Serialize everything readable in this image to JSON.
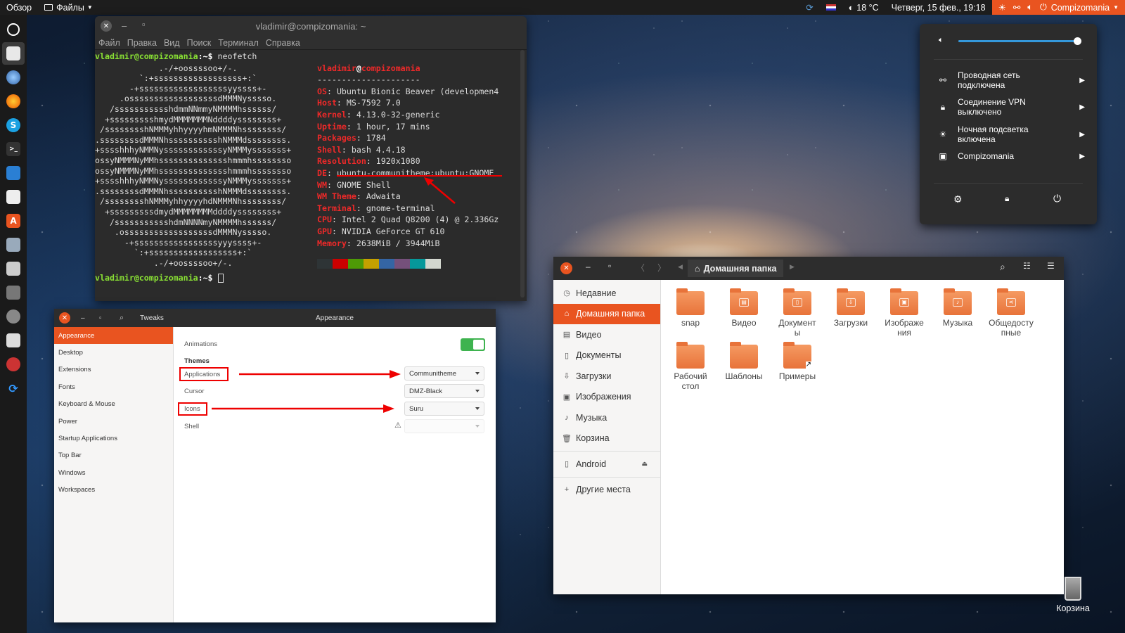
{
  "topbar": {
    "overview": "Обзор",
    "files_menu": "Файлы",
    "weather": "18 °C",
    "datetime": "Четверг, 15 фев., 19:18",
    "user": "Compizomania"
  },
  "terminal": {
    "title": "vladimir@compizomania: ~",
    "menu": [
      "Файл",
      "Правка",
      "Вид",
      "Поиск",
      "Терминал",
      "Справка"
    ],
    "prompt": "vladimir@compizomania",
    "prompt_suffix": ":~$",
    "command": "neofetch",
    "user": "vladimir",
    "host": "compizomania",
    "separator": "---------------------",
    "logo": [
      "             .-/+oossssoo+/-.",
      "         `:+ssssssssssssssssss+:`",
      "       -+ssssssssssssssssssyyssss+-",
      "     .ossssssssssssssssssdMMMNysssso.",
      "   /ssssssssssshdmmNNmmyNMMMMhssssss/",
      "  +ssssssssshmydMMMMMMMNddddyssssssss+",
      " /sssssssshNMMMyhhyyyyhmNMMMNhssssssss/",
      ".ssssssssdMMMNhsssssssssshNMMMdssssssss.",
      "+sssshhhyNMMNyssssssssssssyNMMMysssssss+",
      "ossyNMMMNyMMhsssssssssssssshmmmhssssssso",
      "ossyNMMMNyMMhsssssssssssssshmmmhssssssso",
      "+sssshhhyNMMNyssssssssssssyNMMMysssssss+",
      ".ssssssssdMMMNhsssssssssshNMMMdssssssss.",
      " /sssssssshNMMMyhhyyyyhdNMMMNhssssssss/",
      "  +sssssssssdmydMMMMMMMMddddyssssssss+",
      "   /ssssssssssshdmNNNNmyNMMMMhssssss/",
      "    .ossssssssssssssssssdMMMNysssso.",
      "      -+sssssssssssssssssyyyssss+-",
      "        `:+ssssssssssssssssss+:`",
      "            .-/+oossssoo+/-."
    ],
    "info": [
      {
        "key": "OS",
        "value": "Ubuntu Bionic Beaver (developmen4"
      },
      {
        "key": "Host",
        "value": "MS-7592 7.0"
      },
      {
        "key": "Kernel",
        "value": "4.13.0-32-generic"
      },
      {
        "key": "Uptime",
        "value": "1 hour, 17 mins"
      },
      {
        "key": "Packages",
        "value": "1784"
      },
      {
        "key": "Shell",
        "value": "bash 4.4.18"
      },
      {
        "key": "Resolution",
        "value": "1920x1080"
      },
      {
        "key": "DE",
        "value": "ubuntu-communitheme:ubuntu:GNOME"
      },
      {
        "key": "WM",
        "value": "GNOME Shell"
      },
      {
        "key": "WM Theme",
        "value": "Adwaita"
      },
      {
        "key": "Terminal",
        "value": "gnome-terminal"
      },
      {
        "key": "CPU",
        "value": "Intel 2 Quad Q8200 (4) @ 2.336Gz"
      },
      {
        "key": "GPU",
        "value": "NVIDIA GeForce GT 610"
      },
      {
        "key": "Memory",
        "value": "2638MiB / 3944MiB"
      }
    ],
    "palette": [
      "#2e3436",
      "#cc0000",
      "#4e9a06",
      "#c4a000",
      "#3465a4",
      "#75507b",
      "#06989a",
      "#d3d7cf"
    ]
  },
  "tweaks": {
    "app_title": "Tweaks",
    "panel_title": "Appearance",
    "sidebar": [
      "Appearance",
      "Desktop",
      "Extensions",
      "Fonts",
      "Keyboard & Mouse",
      "Power",
      "Startup Applications",
      "Top Bar",
      "Windows",
      "Workspaces"
    ],
    "animations_label": "Animations",
    "animations_on": true,
    "themes_heading": "Themes",
    "applications_label": "Applications",
    "applications_value": "Communitheme",
    "cursor_label": "Cursor",
    "cursor_value": "DMZ-Black",
    "icons_label": "Icons",
    "icons_value": "Suru",
    "shell_label": "Shell",
    "shell_value": ""
  },
  "files": {
    "path": "Домашняя папка",
    "sidebar": [
      {
        "label": "Недавние",
        "icon": "clock-icon"
      },
      {
        "label": "Домашняя папка",
        "icon": "home-icon"
      },
      {
        "label": "Видео",
        "icon": "video-icon"
      },
      {
        "label": "Документы",
        "icon": "document-icon"
      },
      {
        "label": "Загрузки",
        "icon": "download-icon"
      },
      {
        "label": "Изображения",
        "icon": "image-icon"
      },
      {
        "label": "Музыка",
        "icon": "music-icon"
      },
      {
        "label": "Корзина",
        "icon": "trash-icon"
      }
    ],
    "device": "Android",
    "other_places": "Другие места",
    "items": [
      "snap",
      "Видео",
      "Документы",
      "Загрузки",
      "Изображения",
      "Музыка",
      "Общедоступные",
      "Рабочий стол",
      "Шаблоны",
      "Примеры"
    ],
    "item_lines": [
      [
        "snap"
      ],
      [
        "Видео"
      ],
      [
        "Документ",
        "ы"
      ],
      [
        "Загрузки"
      ],
      [
        "Изображе",
        "ния"
      ],
      [
        "Музыка"
      ],
      [
        "Общедосту",
        "пные"
      ],
      [
        "Рабочий",
        "стол"
      ],
      [
        "Шаблоны"
      ],
      [
        "Примеры"
      ]
    ]
  },
  "system_menu": {
    "volume_level": 1.0,
    "items": [
      {
        "icon": "network-icon",
        "line1": "Проводная сеть",
        "line2": "подключена"
      },
      {
        "icon": "lock-icon",
        "line1": "Соединение VPN",
        "line2": "выключено"
      },
      {
        "icon": "night-light-icon",
        "line1": "Ночная подсветка",
        "line2": "включена"
      },
      {
        "icon": "user-avatar-icon",
        "line1": "Compizomania",
        "line2": ""
      }
    ]
  },
  "desktop": {
    "trash_label": "Корзина"
  },
  "colors": {
    "accent": "#e95420",
    "terminal_green": "#8ae234",
    "terminal_red": "#ef2929"
  }
}
